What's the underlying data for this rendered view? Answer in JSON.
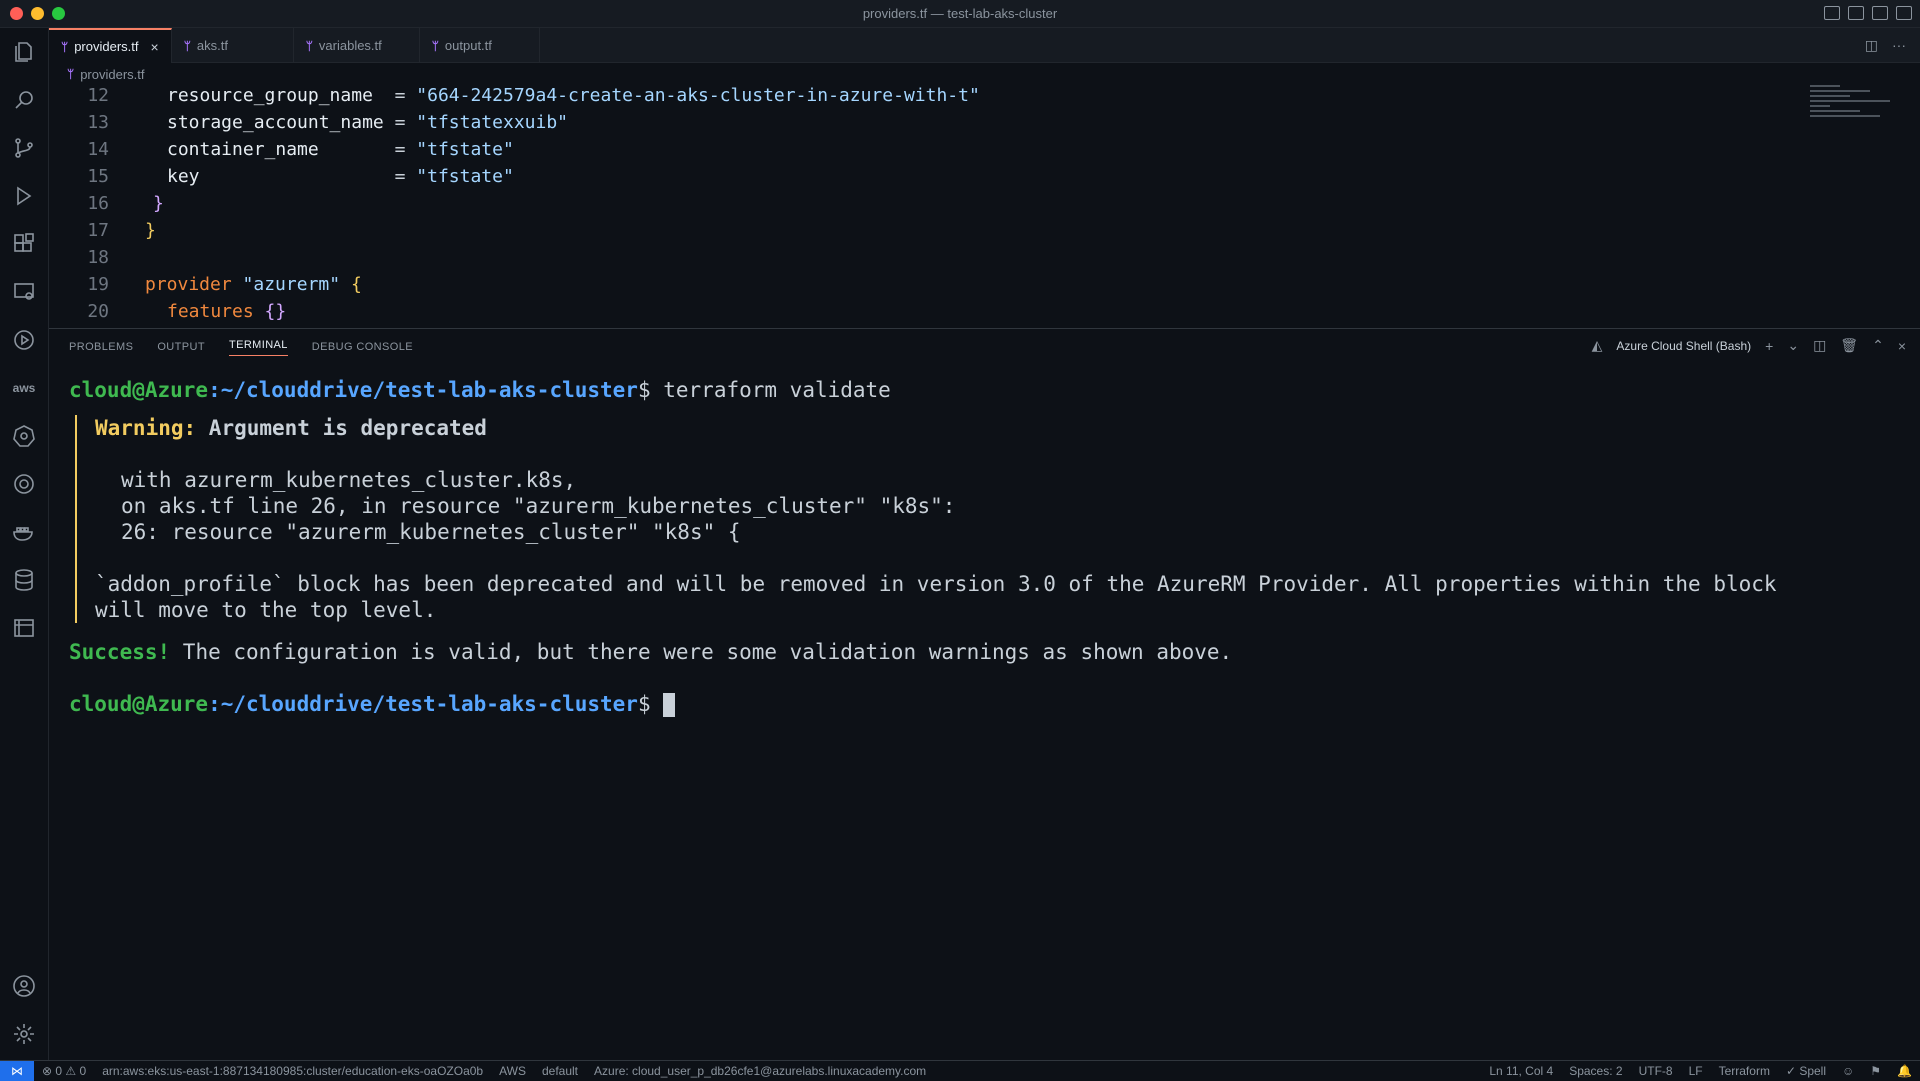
{
  "window": {
    "title": "providers.tf — test-lab-aks-cluster"
  },
  "tabs": [
    {
      "label": "providers.tf",
      "active": true
    },
    {
      "label": "aks.tf",
      "active": false
    },
    {
      "label": "variables.tf",
      "active": false
    },
    {
      "label": "output.tf",
      "active": false
    }
  ],
  "breadcrumb": {
    "file": "providers.tf"
  },
  "editor": {
    "lines": [
      {
        "num": "12",
        "key": "resource_group_name",
        "pad": "  ",
        "value": "\"664-242579a4-create-an-aks-cluster-in-azure-with-t\""
      },
      {
        "num": "13",
        "key": "storage_account_name",
        "pad": " ",
        "value": "\"tfstatexxuib\""
      },
      {
        "num": "14",
        "key": "container_name",
        "pad": "       ",
        "value": "\"tfstate\""
      },
      {
        "num": "15",
        "key": "key",
        "pad": "                  ",
        "value": "\"tfstate\""
      },
      {
        "num": "16",
        "text": "}"
      },
      {
        "num": "17",
        "text": "}"
      },
      {
        "num": "18",
        "text": ""
      },
      {
        "num": "19",
        "kw": "provider",
        "str": "\"azurerm\"",
        "brace": "{"
      },
      {
        "num": "20",
        "text": "features",
        "brace": "{}"
      }
    ]
  },
  "panel": {
    "tabs": [
      "PROBLEMS",
      "OUTPUT",
      "TERMINAL",
      "DEBUG CONSOLE"
    ],
    "active_tab": "TERMINAL",
    "shell_name": "Azure Cloud Shell (Bash)"
  },
  "terminal": {
    "prompt_user": "cloud@Azure",
    "prompt_path": ":~/clouddrive/test-lab-aks-cluster",
    "prompt_dollar": "$",
    "command": " terraform validate",
    "warning_label": "Warning:",
    "warning_title": " Argument is deprecated",
    "with_line": "with azurerm_kubernetes_cluster.k8s,",
    "on_line": "on aks.tf line 26, in resource \"azurerm_kubernetes_cluster\" \"k8s\":",
    "src_line": "26: resource \"azurerm_kubernetes_cluster\" \"k8s\" {",
    "desc_line1": "`addon_profile` block has been deprecated and will be removed in version 3.0 of the AzureRM Provider. All properties within the block",
    "desc_line2": "will move to the top level.",
    "success_label": "Success!",
    "success_text": " The configuration is valid, but there were some validation warnings as shown above."
  },
  "statusbar": {
    "remote_icon": "remote-icon",
    "errors": "0",
    "warnings": "0",
    "cluster": "arn:aws:eks:us-east-1:887134180985:cluster/education-eks-oaOZOa0b",
    "aws": "AWS",
    "profile": "default",
    "azure": "Azure: cloud_user_p_db26cfe1@azurelabs.linuxacademy.com",
    "position": "Ln 11, Col 4",
    "spaces": "Spaces: 2",
    "encoding": "UTF-8",
    "eol": "LF",
    "language": "Terraform",
    "spell": "Spell"
  },
  "colors": {
    "accent": "#1f6feb",
    "prompt_user": "#3fb950",
    "prompt_path": "#58a6ff",
    "warning": "#f2cc60"
  }
}
